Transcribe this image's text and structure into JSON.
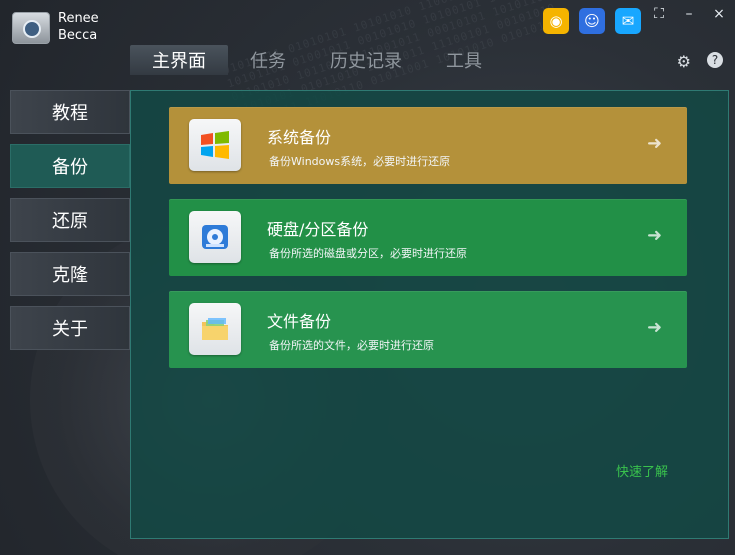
{
  "app": {
    "name_line1": "Renee",
    "name_line2": "Becca"
  },
  "header": {
    "tabs": [
      {
        "label": "主界面",
        "active": true
      },
      {
        "label": "任务",
        "active": false
      },
      {
        "label": "历史记录",
        "active": false
      },
      {
        "label": "工具",
        "active": false
      }
    ],
    "icons": {
      "weibo": "weibo-icon",
      "qq": "qq-icon",
      "chat": "chat-icon",
      "settings": "gear-icon",
      "help": "help-icon",
      "skin": "tshirt-icon",
      "minimize": "minimize-icon",
      "close": "close-icon"
    }
  },
  "sidebar": {
    "items": [
      {
        "label": "教程",
        "active": false
      },
      {
        "label": "备份",
        "active": true
      },
      {
        "label": "还原",
        "active": false
      },
      {
        "label": "克隆",
        "active": false
      },
      {
        "label": "关于",
        "active": false
      }
    ]
  },
  "main": {
    "cards": [
      {
        "title": "系统备份",
        "desc": "备份Windows系统，必要时进行还原",
        "icon": "windows-logo-icon",
        "color": "#b4913a"
      },
      {
        "title": "硬盘/分区备份",
        "desc": "备份所选的磁盘或分区，必要时进行还原",
        "icon": "disk-icon",
        "color": "#229047"
      },
      {
        "title": "文件备份",
        "desc": "备份所选的文件，必要时进行还原",
        "icon": "folder-icon",
        "color": "#27934f"
      }
    ],
    "quick_link": "快速了解"
  },
  "colors": {
    "panel": "#134844",
    "accent_green": "#39c24d"
  }
}
